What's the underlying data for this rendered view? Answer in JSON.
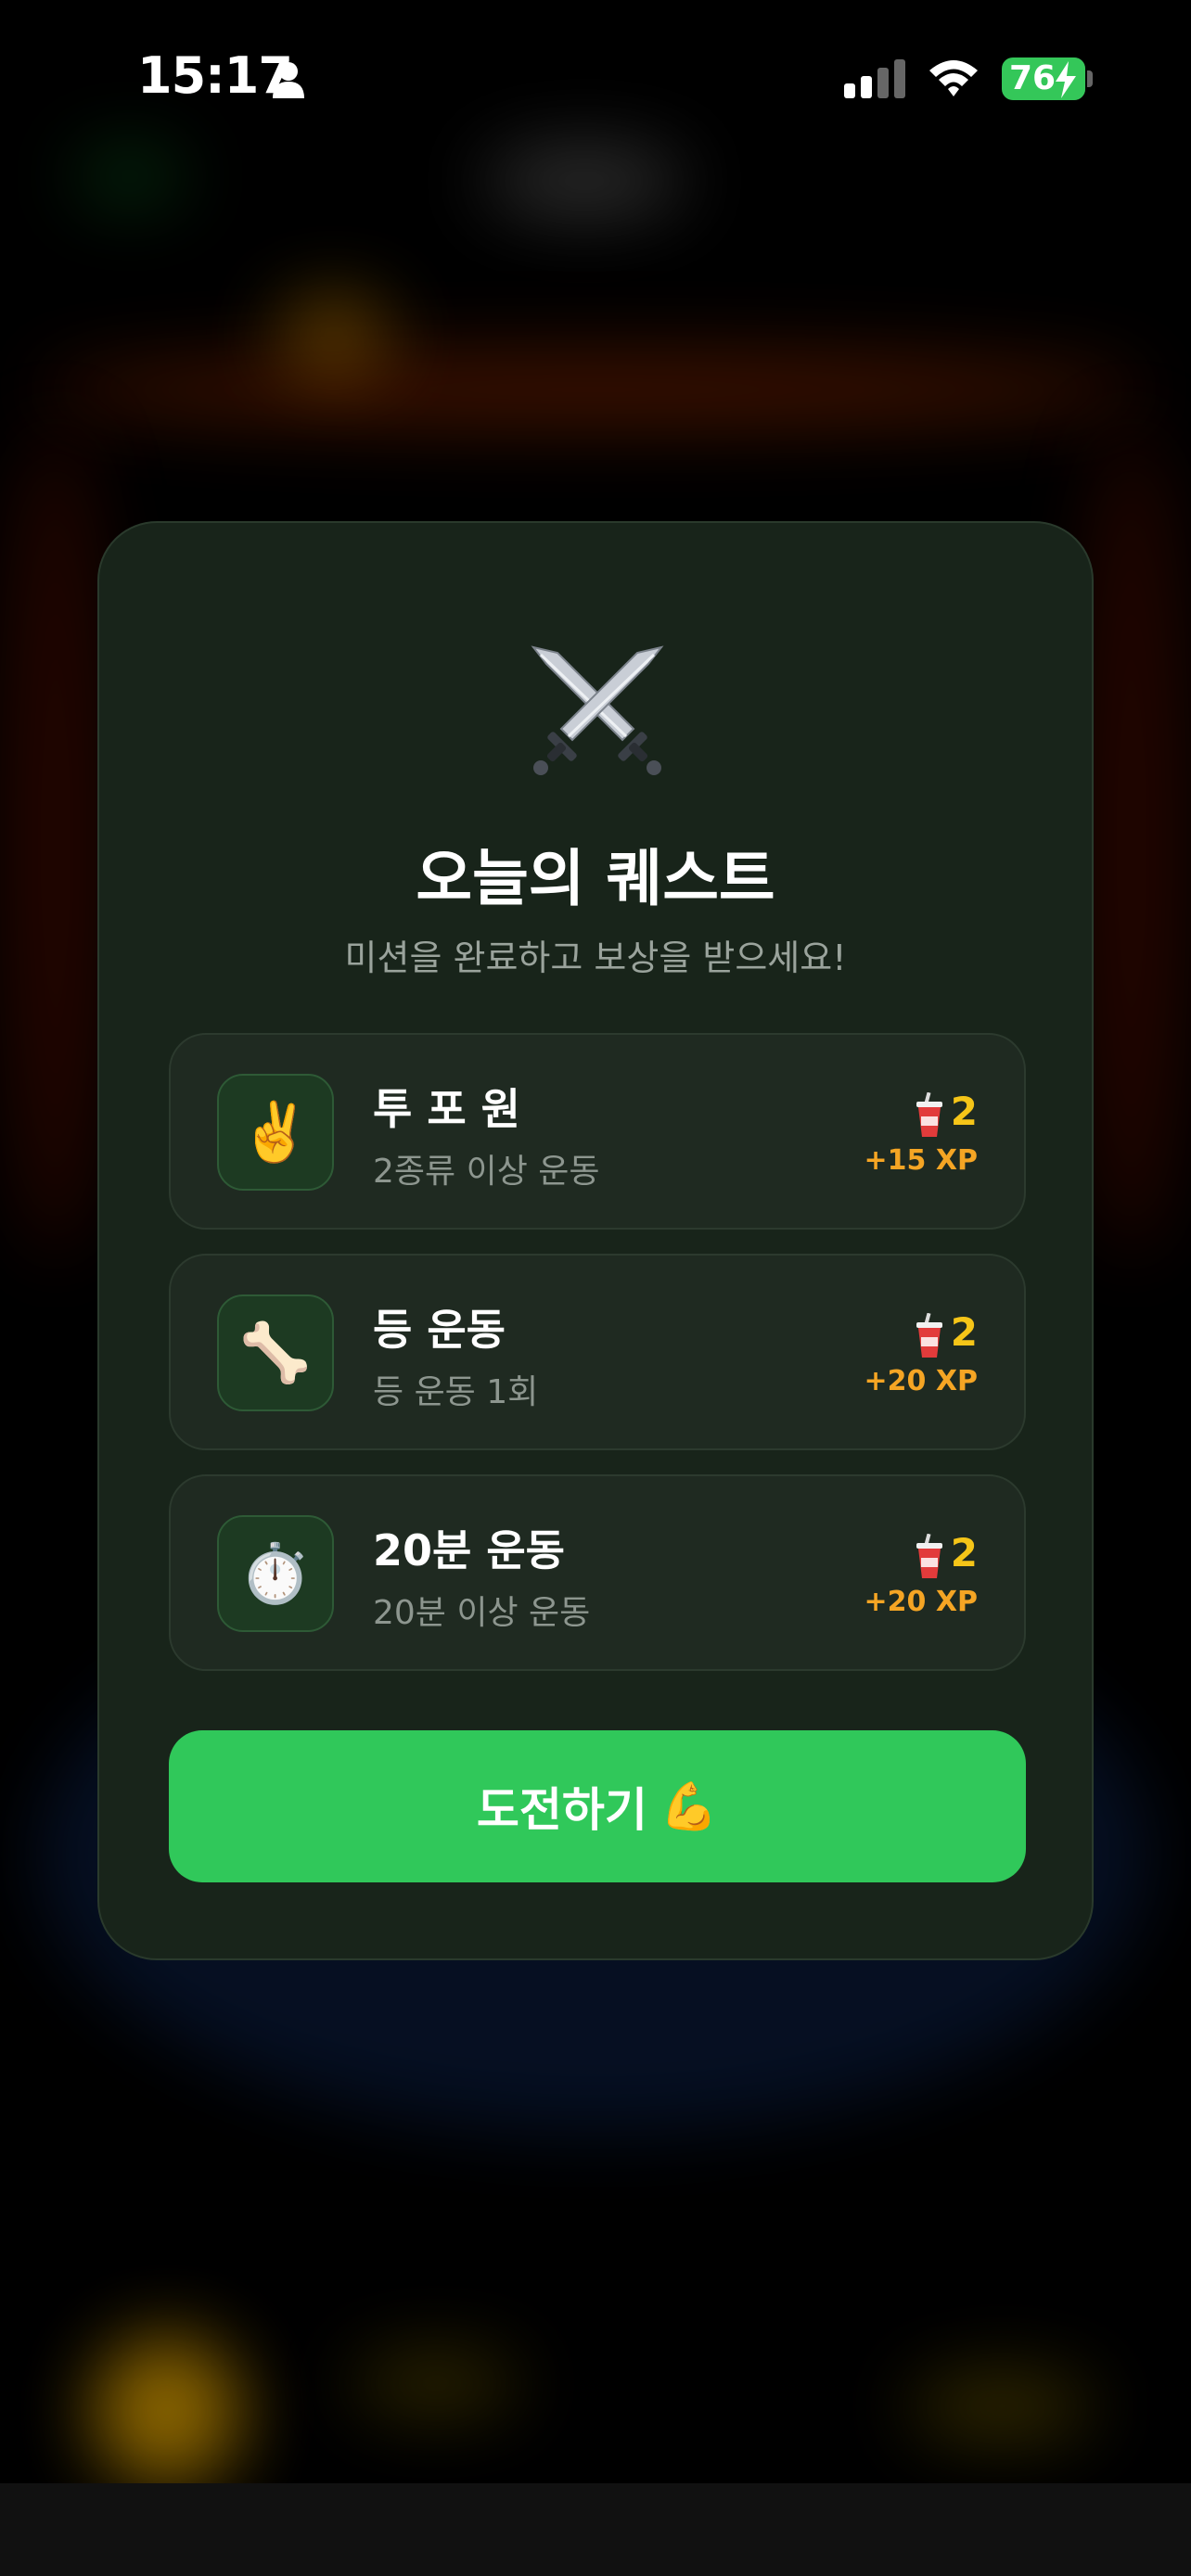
{
  "status_bar": {
    "time": "15:17",
    "battery_level": "76",
    "icons": [
      "person-icon",
      "signal-icon",
      "wifi-icon",
      "battery-charging-icon"
    ]
  },
  "modal": {
    "icon": "crossed-swords-icon",
    "title": "오늘의 퀘스트",
    "subtitle": "미션을 완료하고 보상을 받으세요!",
    "quests": [
      {
        "icon": "victory-hand-icon",
        "emoji": "✌️",
        "title": "투 포 원",
        "description": "2종류 이상 운동",
        "reward_count": "2",
        "reward_xp": "+15 XP"
      },
      {
        "icon": "bone-icon",
        "emoji": "🦴",
        "title": "등 운동",
        "description": "등 운동 1회",
        "reward_count": "2",
        "reward_xp": "+20 XP"
      },
      {
        "icon": "stopwatch-icon",
        "emoji": "⏱️",
        "title": "20분 운동",
        "description": "20분 이상 운동",
        "reward_count": "2",
        "reward_xp": "+20 XP"
      }
    ],
    "challenge_button": {
      "label": "도전하기",
      "emoji": "💪"
    }
  },
  "colors": {
    "accent_green": "#30c85a",
    "modal_bg": "#18241a",
    "reward_yellow": "#f5c518",
    "xp_orange": "#f5a524"
  }
}
